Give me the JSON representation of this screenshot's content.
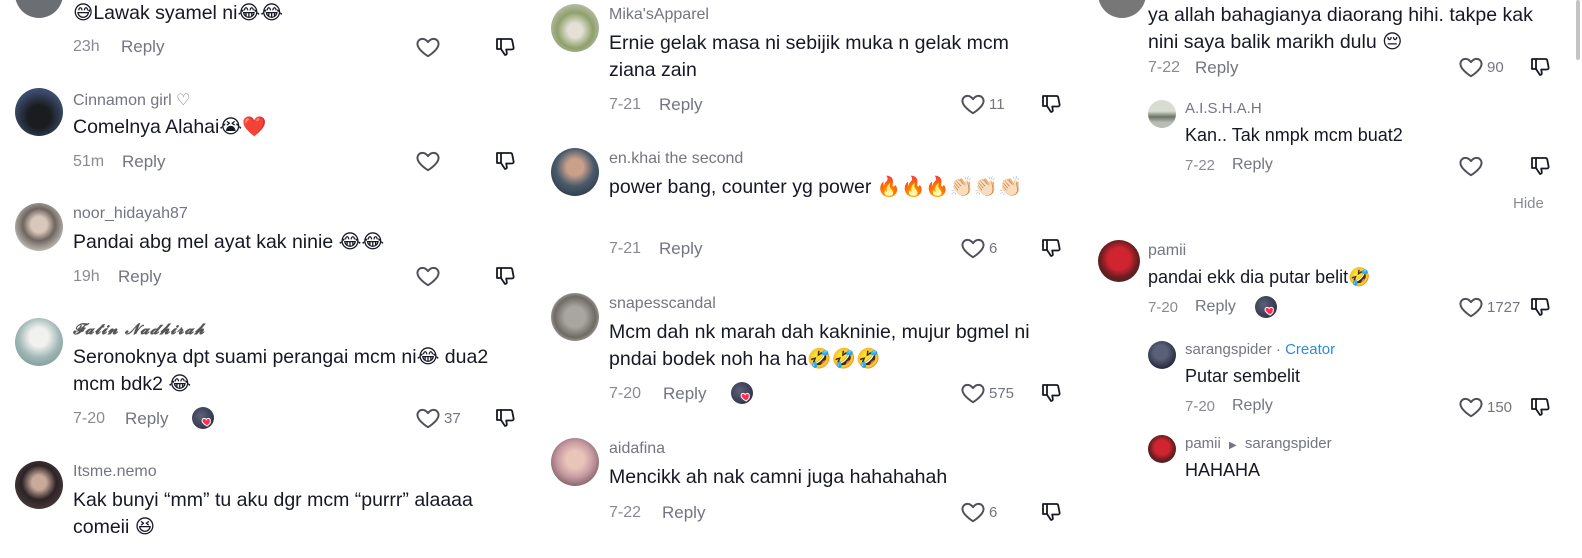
{
  "columns": [
    {
      "comments": [
        {
          "username": "",
          "text": "😅Lawak syamel ni😂😂",
          "time": "23h",
          "reply": "Reply",
          "likes": "",
          "avatar_color": "#6b6f73"
        },
        {
          "username": "Cinnamon girl ♡",
          "text": "Comelnya Alahai😭❤️",
          "time": "51m",
          "reply": "Reply",
          "likes": "",
          "avatar_color": "#1f2a44"
        },
        {
          "username": "noor_hidayah87",
          "text": "Pandai abg mel ayat kak ninie 😂😂",
          "time": "19h",
          "reply": "Reply",
          "likes": "",
          "avatar_color": "#8a7f79"
        },
        {
          "username": "𝓕𝓪𝓽𝓲𝓷 𝓝𝓪𝓭𝓱𝓲𝓻𝓪𝓱",
          "text": "Seronoknya dpt suami perangai mcm ni😂 dua2 mcm bdk2 😂",
          "time": "7-20",
          "reply": "Reply",
          "likes": "37",
          "avatar_color": "#9fb7b6"
        },
        {
          "username": "Itsme.nemo",
          "text": "Kak bunyi “mm” tu aku dgr mcm “purrr” alaaaa comeii 😆",
          "time": "",
          "reply": "",
          "likes": "",
          "avatar_color": "#2d2326"
        }
      ]
    },
    {
      "comments": [
        {
          "username": "Mika'sApparel",
          "text": "Ernie gelak masa ni sebijik muka n gelak mcm ziana zain",
          "time": "7-21",
          "reply": "Reply",
          "likes": "11",
          "avatar_color": "#8fa06b"
        },
        {
          "username": "en.khai the second",
          "text": "power bang, counter yg power 🔥🔥🔥👏🏻👏🏻👏🏻",
          "time": "7-21",
          "reply": "Reply",
          "likes": "6",
          "avatar_color": "#4a5b6c"
        },
        {
          "username": "snapesscandal",
          "text": "Mcm dah nk marah dah kakninie, mujur bgmel ni pndai bodek noh ha ha🤣🤣🤣",
          "time": "7-20",
          "reply": "Reply",
          "likes": "575",
          "avatar_color": "#a9a6a1"
        },
        {
          "username": "aidafina",
          "text": "Mencikk ah nak camni juga hahahahah",
          "time": "7-22",
          "reply": "Reply",
          "likes": "6",
          "avatar_color": "#c79aa2"
        }
      ]
    },
    {
      "comments": [
        {
          "username": "",
          "text": "ya allah bahagianya diaorang hihi. takpe kak nini saya balik marikh dulu 😔",
          "time": "7-22",
          "reply": "Reply",
          "likes": "90",
          "avatar_color": "#777777"
        },
        {
          "username": "A.I.S.H.A.H",
          "text": "Kan.. Tak nmpk mcm buat2",
          "time": "7-22",
          "reply": "Reply",
          "likes": "",
          "avatar_color": "#b8bcb2"
        },
        {
          "username": "pamii",
          "text": "pandai ekk dia putar belit🤣",
          "time": "7-20",
          "reply": "Reply",
          "likes": "1727",
          "avatar_color": "#c0222a"
        },
        {
          "username": "sarangspider",
          "creator_label": "Creator",
          "text": "Putar sembelit",
          "time": "7-20",
          "reply": "Reply",
          "likes": "150",
          "avatar_color": "#34384a"
        },
        {
          "username": "pamii",
          "reply_to": "sarangspider",
          "text": "HAHAHA",
          "time": "",
          "reply": "",
          "likes": "",
          "avatar_color": "#c0222a"
        }
      ],
      "hide_label": "Hide"
    }
  ],
  "icons": {
    "like": "heart-outline-icon",
    "dislike": "thumbs-down-icon",
    "creator_liked": "creator-liked-avatar-icon"
  },
  "colors": {
    "text": "#161823",
    "secondary": "#737580",
    "creator": "#2f8cd9"
  }
}
